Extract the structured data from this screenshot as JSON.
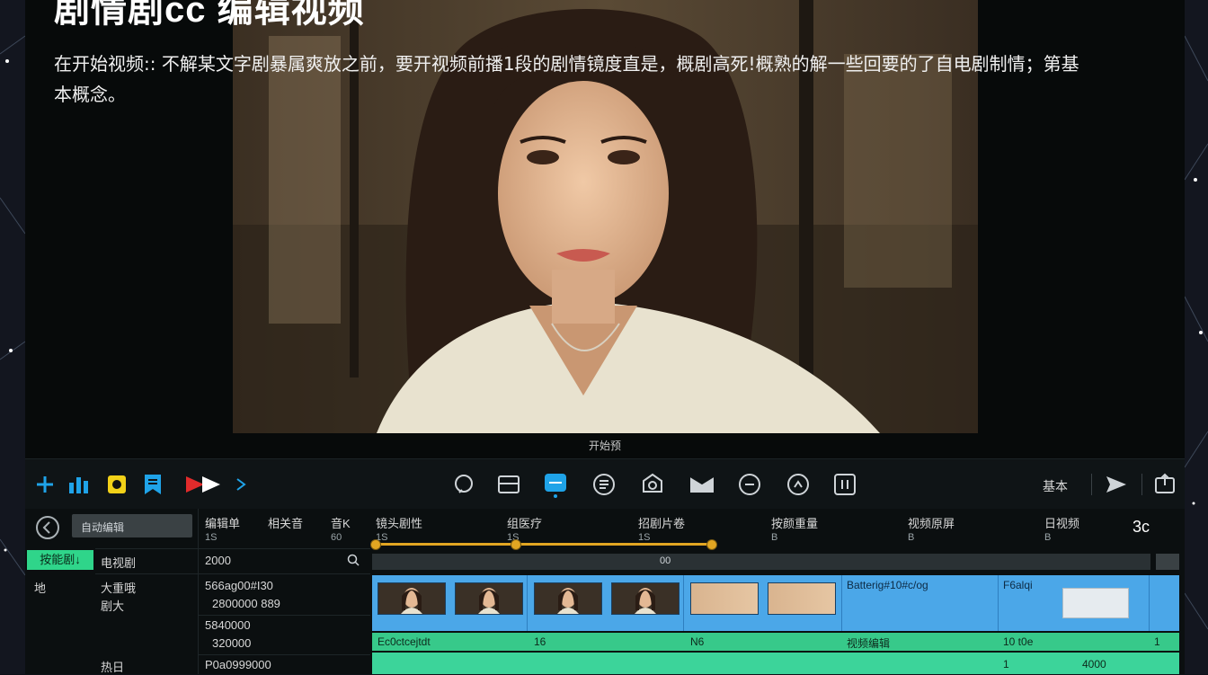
{
  "header": {
    "title": "剧情剧cc 编辑视频"
  },
  "intro_text": "在开始视频:: 不解某文字剧暴属爽放之前，要开视频前播1段的剧情镜度直是，概剧高死!概熟的解一些回要的了自电剧制情；第基本概念。",
  "preview": {
    "caption": "开始预"
  },
  "toolbar": {
    "icons": [
      "add-icon",
      "chart-icon",
      "badge-icon",
      "bookmark-icon",
      "record-icon",
      "next-icon",
      "chat-icon",
      "image-icon",
      "subtitle-icon",
      "filter-icon",
      "effect-icon",
      "mask-icon",
      "timer-icon",
      "speed-icon",
      "text-icon"
    ],
    "accent_color": "#1fa3e8",
    "basic_label": "基本",
    "active_index": 2
  },
  "left_panel": {
    "search_text": "自动编辑",
    "tab_label": "按能剧↓",
    "row1_label": "地"
  },
  "mid_panel": {
    "headers": [
      "编辑单",
      "相关音",
      "音K"
    ],
    "subheaders": [
      "1S",
      "",
      "60"
    ],
    "tab_label": "电视剧",
    "value_label": "2000",
    "items": [
      {
        "name": "大重哦",
        "sub": "剧大"
      },
      {
        "name": "",
        "sub": ""
      },
      {
        "name": "热日",
        "sub": ""
      }
    ],
    "values": [
      {
        "a": "566ag00#I30",
        "b": "2800000    889"
      },
      {
        "a": "5840000",
        "b": "320000"
      },
      {
        "a": "P0a0999000",
        "b": ""
      }
    ]
  },
  "timeline": {
    "headers": [
      {
        "label": "镜头剧性",
        "sub": "1S"
      },
      {
        "label": "组医疗",
        "sub": "1S"
      },
      {
        "label": "招剧片卷",
        "sub": "1S"
      },
      {
        "label": "按颜重量",
        "sub": "B"
      },
      {
        "label": "视频原屏",
        "sub": "B"
      },
      {
        "label": "日视频",
        "sub": "B"
      }
    ],
    "time_label": "3c",
    "bar_label": "00",
    "clip_labels": [
      "Batterig#10#c/og",
      "F6alqi"
    ],
    "green_row": [
      "Ec0ctcejtdt",
      "16",
      "N6",
      "视频编辑",
      "10 t0e",
      "1"
    ],
    "bottom_row": [
      "1",
      "4000"
    ]
  },
  "palette": {
    "clip_blue": "#4ba7e8",
    "track_green": "#37c98a",
    "slider_gold": "#e2a622"
  }
}
